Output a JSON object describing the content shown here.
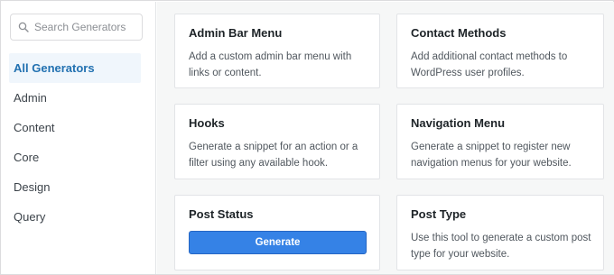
{
  "search": {
    "placeholder": "Search Generators"
  },
  "sidebar": {
    "items": [
      {
        "label": "All Generators"
      },
      {
        "label": "Admin"
      },
      {
        "label": "Content"
      },
      {
        "label": "Core"
      },
      {
        "label": "Design"
      },
      {
        "label": "Query"
      }
    ],
    "active_index": 0
  },
  "cards": [
    {
      "title": "Admin Bar Menu",
      "description": "Add a custom admin bar menu with links or content."
    },
    {
      "title": "Contact Methods",
      "description": "Add additional contact methods to WordPress user profiles."
    },
    {
      "title": "Hooks",
      "description": "Generate a snippet for an action or a filter using any available hook."
    },
    {
      "title": "Navigation Menu",
      "description": "Generate a snippet to register new navigation menus for your website."
    },
    {
      "title": "Post Status",
      "button_label": "Generate"
    },
    {
      "title": "Post Type",
      "description": "Use this tool to generate a custom post type for your website."
    }
  ],
  "colors": {
    "accent": "#2271b1",
    "button": "#3582e6",
    "main_background": "#f6f7f7"
  },
  "icons": {
    "search": "search-icon"
  }
}
